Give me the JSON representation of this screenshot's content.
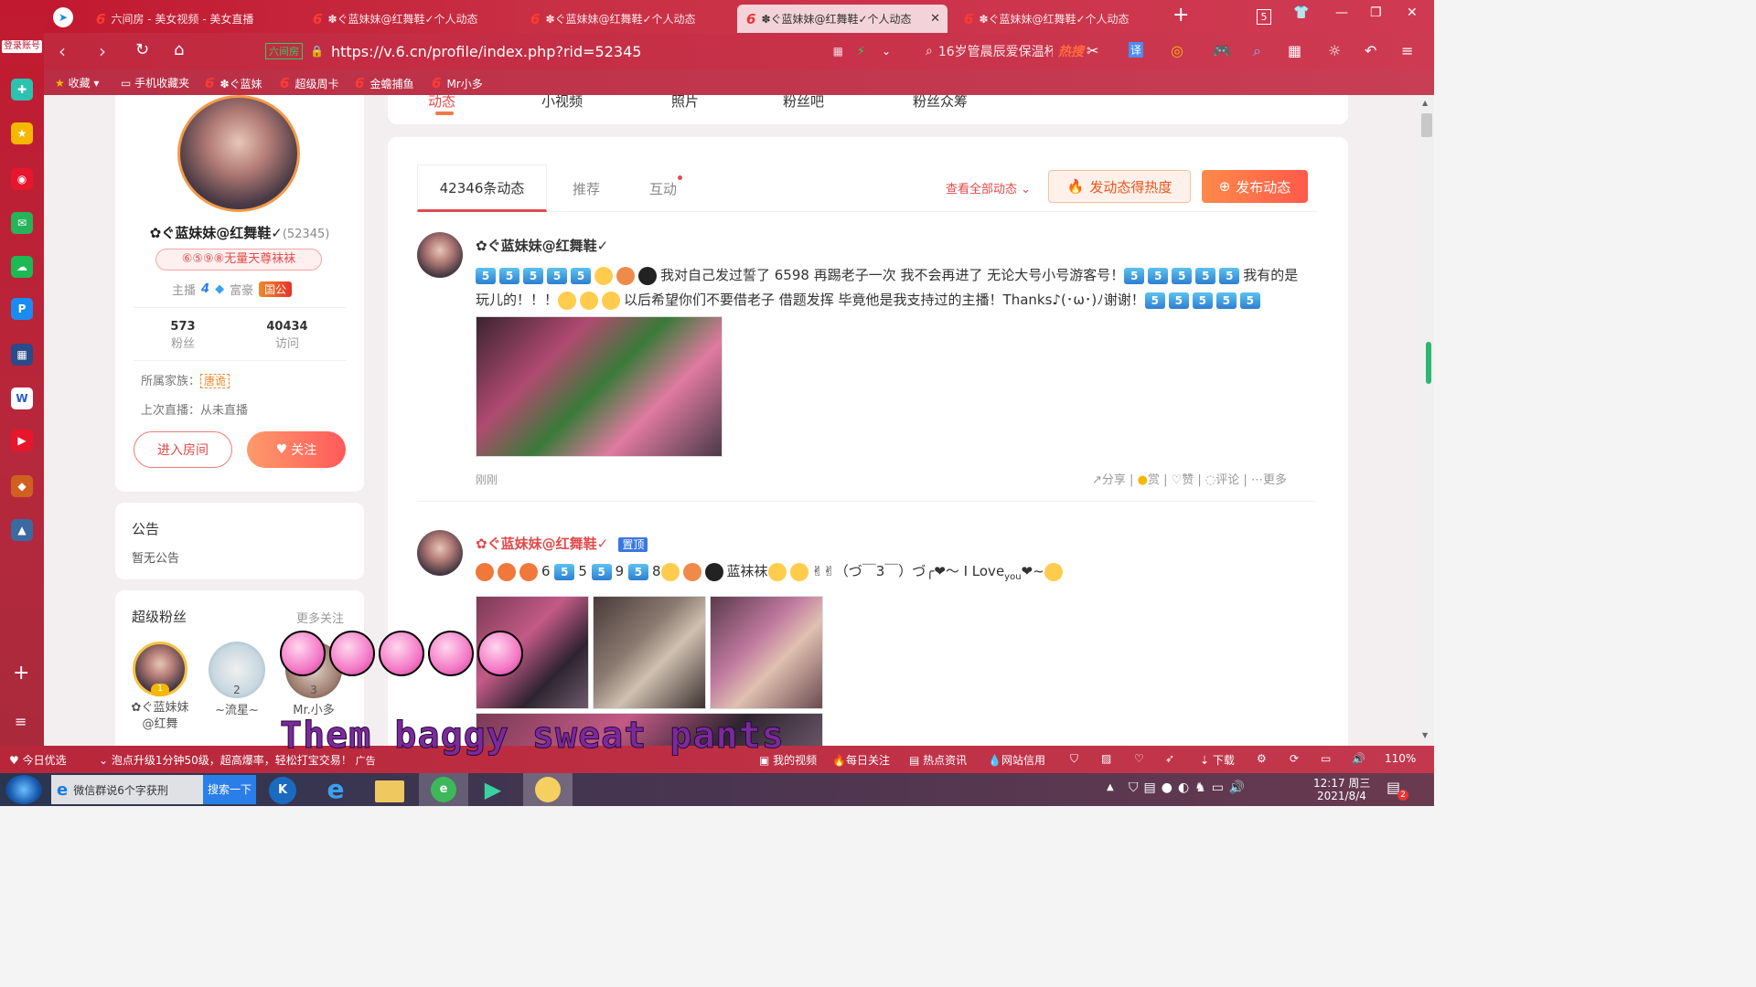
{
  "browser": {
    "tabs": [
      {
        "label": "六间房 - 美女视频 - 美女直播"
      },
      {
        "label": "✽ぐ蓝妹妹@红舞鞋✓个人动态"
      },
      {
        "label": "✽ぐ蓝妹妹@红舞鞋✓个人动态"
      },
      {
        "label": "✽ぐ蓝妹妹@红舞鞋✓个人动态"
      },
      {
        "label": "✽ぐ蓝妹妹@红舞鞋✓个人动态"
      }
    ],
    "tab_count": "5",
    "url_prefix": "六间房",
    "url": "https://v.6.cn/profile/index.php?rid=52345",
    "search_text": "16岁管晨辰爱保温杯",
    "search_hot": "热搜",
    "login_label": "登录账号",
    "bookmarks": [
      "收藏",
      "手机收藏夹",
      "✽ぐ蓝妹",
      "超级周卡",
      "金蟾捕鱼",
      "Mr小多"
    ]
  },
  "profile": {
    "name": "✿ぐ蓝妹妹@红舞鞋✓",
    "rid": "(52345)",
    "tag": "⑥⑤⑨⑧无量天尊袜袜",
    "anchor_label": "主播",
    "anchor_level": "4",
    "rich_label": "富豪",
    "rich_badge": "国公",
    "fans_count": "573",
    "fans_label": "粉丝",
    "visits_count": "40434",
    "visits_label": "访问",
    "family_label": "所属家族：",
    "family_name": "唐诡",
    "last_live_label": "上次直播：从未直播",
    "enter_room_label": "进入房间",
    "follow_label": "关注"
  },
  "notice": {
    "title": "公告",
    "content": "暂无公告"
  },
  "super_fans": {
    "title": "超级粉丝",
    "more": "更多关注",
    "fans": [
      {
        "rank": "1",
        "name": "✿ぐ蓝妹妹@红舞"
      },
      {
        "rank": "2",
        "name": "~流星~"
      },
      {
        "rank": "3",
        "name": "Mr.小多"
      }
    ]
  },
  "top_nav": {
    "items": [
      "动态",
      "小视频",
      "照片",
      "粉丝吧",
      "粉丝众筹"
    ]
  },
  "feed": {
    "tabs": [
      "42346条动态",
      "推荐",
      "互动"
    ],
    "view_all": "查看全部动态",
    "hot_button": "发动态得热度",
    "publish_button": "发布动态",
    "posts": [
      {
        "author": "✿ぐ蓝妹妹@红舞鞋✓",
        "text_1": "我对自己发过誓了 6598 再踢老子一次 我不会再进了 无论大号小号游客号！",
        "text_2": "我有的是",
        "text_3": "玩儿的！！！",
        "text_4": "以后希望你们不要借老子 借题发挥 毕竟他是我支持过的主播！Thanks♪(･ω･)ﾉ谢谢！",
        "time": "刚刚",
        "actions": [
          "分享",
          "赏",
          "赞",
          "评论",
          "更多"
        ]
      },
      {
        "author": "✿ぐ蓝妹妹@红舞鞋✓",
        "pinned": "置顶",
        "text_1": "6",
        "text_2": "5",
        "text_3": "9",
        "text_4": "8",
        "text_5": "蓝袜袜",
        "text_6": "（づ￣3￣）づ╭❤～ I Love",
        "text_7": "you",
        "text_8": "❤~"
      }
    ]
  },
  "overlay": {
    "caption": "Them baggy sweat pants"
  },
  "statusbar": {
    "items": [
      "今日优选",
      "泡点升级1分钟50级，超高爆率，轻松打宝交易！",
      "广告",
      "我的视频",
      "每日关注",
      "热点资讯",
      "网站信用",
      "下载",
      "110%"
    ]
  },
  "taskbar": {
    "app_title": "微信群说6个字获刑",
    "search_button": "搜索一下",
    "time": "12:17 周三",
    "date": "2021/8/4",
    "badge": "2"
  }
}
